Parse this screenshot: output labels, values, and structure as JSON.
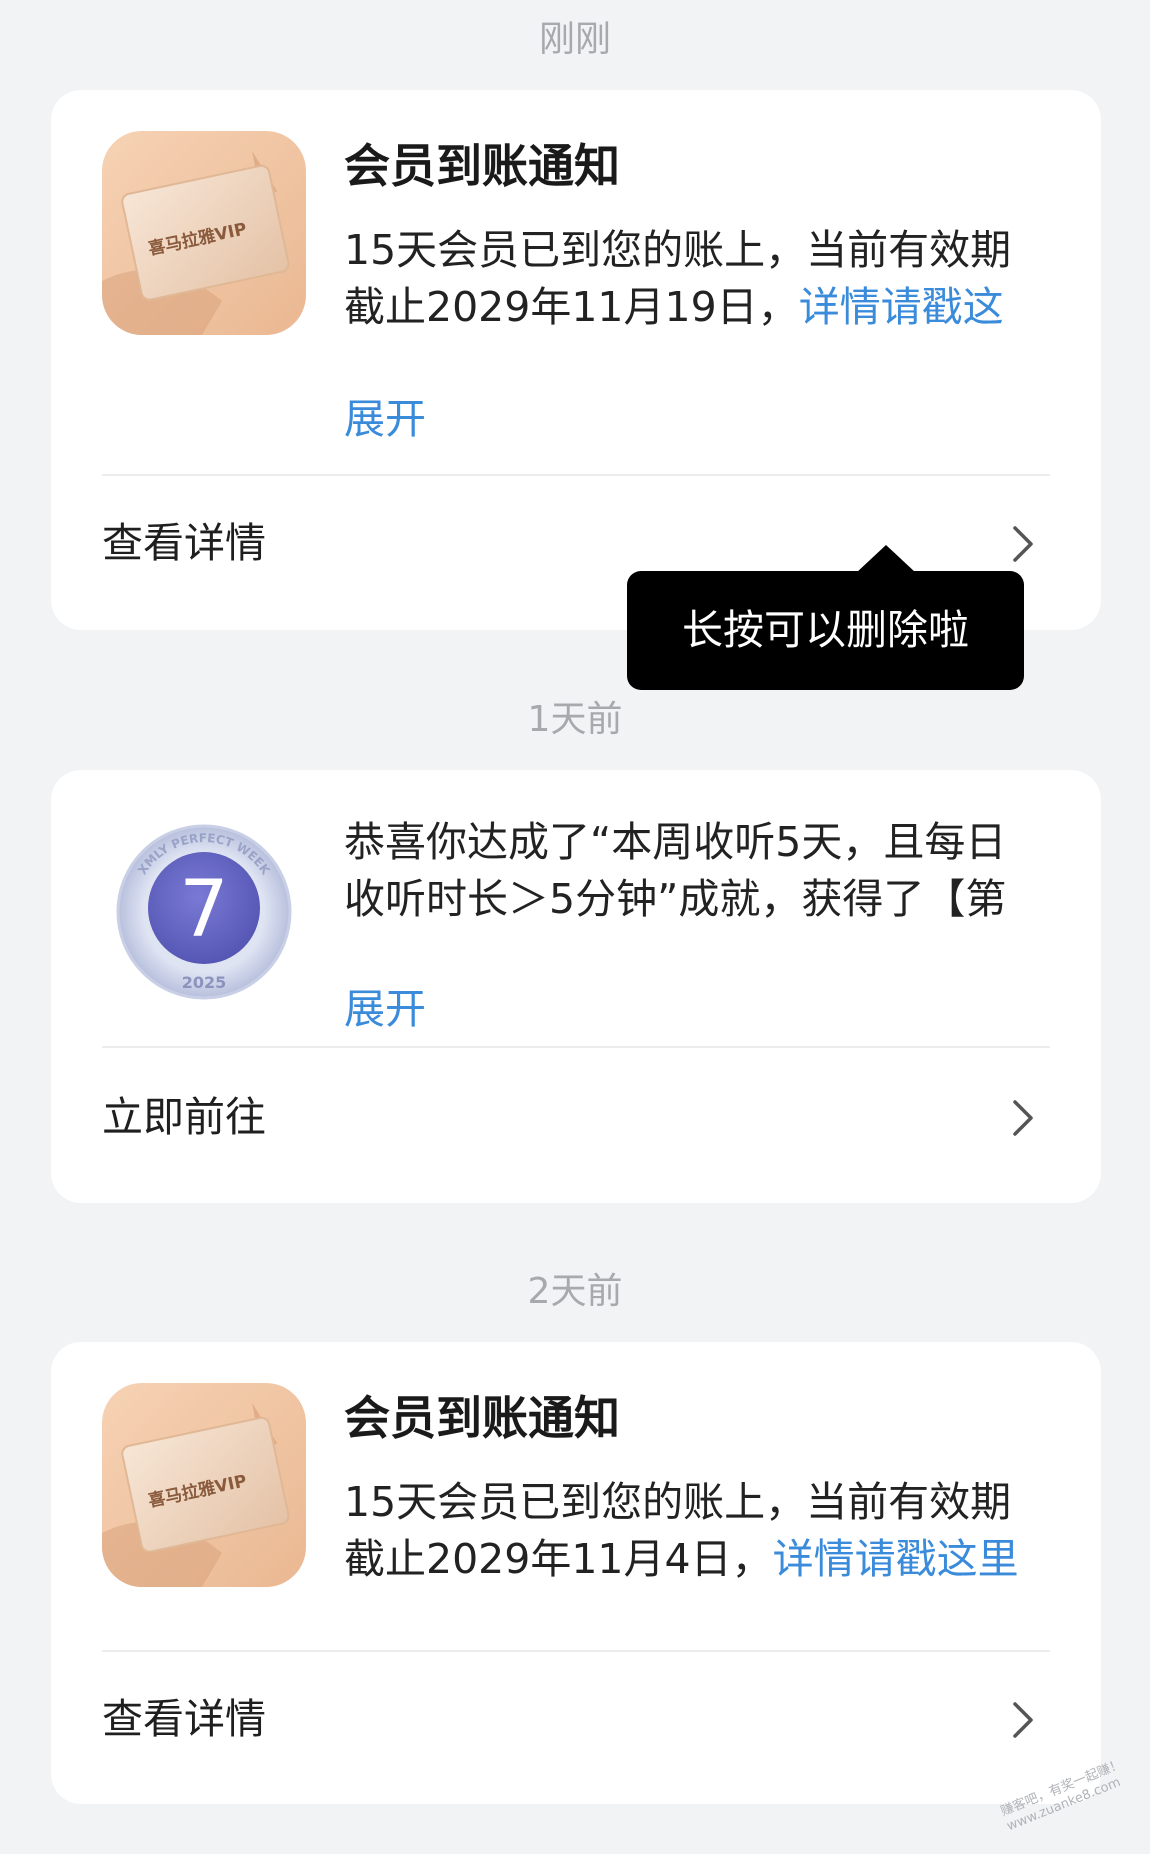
{
  "groups": [
    {
      "time_label": "刚刚",
      "card": {
        "thumb_text": "喜马拉雅VIP",
        "title": "会员到账通知",
        "body_line1": "15天会员已到您的账上，当前有效期",
        "body_line2": "截止2029年11月19日，",
        "body_link": "详情请戳这",
        "expand_label": "展开",
        "footer_label": "查看详情"
      }
    },
    {
      "time_label": "1天前",
      "card": {
        "badge_number": "7",
        "badge_ring_text": "XMLY PERFECT WEEK",
        "badge_year": "2025",
        "body_line1": "恭喜你达成了“本周收听5天，且每日",
        "body_line2": "收听时长＞5分钟”成就，获得了【第",
        "expand_label": "展开",
        "footer_label": "立即前往"
      }
    },
    {
      "time_label": "2天前",
      "card": {
        "thumb_text": "喜马拉雅VIP",
        "title": "会员到账通知",
        "body_line1": "15天会员已到您的账上，当前有效期",
        "body_line2": "截止2029年11月4日，",
        "body_link": "详情请戳这里",
        "footer_label": "查看详情"
      }
    }
  ],
  "tooltip": {
    "text": "长按可以删除啦"
  },
  "watermark": {
    "line1": "赚客吧，有奖一起赚！",
    "line2": "www.zuanke8.com"
  },
  "colors": {
    "background": "#f2f3f5",
    "card": "#ffffff",
    "link": "#3b8bdb",
    "tooltip": "#000000",
    "vip_card": "#f3c9a8",
    "badge": "#6464c4"
  }
}
